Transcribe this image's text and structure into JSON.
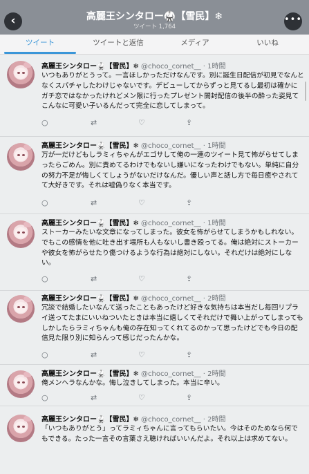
{
  "header": {
    "title": "高麗王シンタロー🥋【雪民】❄",
    "subtitle": "ツイート 1,764",
    "back_glyph": "‹",
    "more_glyph": "•••"
  },
  "tabs": [
    {
      "label": "ツイート",
      "active": true
    },
    {
      "label": "ツイートと返信",
      "active": false
    },
    {
      "label": "メディア",
      "active": false
    },
    {
      "label": "いいね",
      "active": false
    }
  ],
  "action_icons": {
    "reply": "○",
    "retweet": "⇄",
    "like": "♡",
    "share": "⇪"
  },
  "tweets": [
    {
      "name": "高麗王シンタロー🥋【雪民】❄",
      "handle": "@choco_cornet__ · 1時間",
      "text": "いつもありがとうって。一言ほしかっただけなんです。別に誕生日配信が初見でなんとなくスパチャしたわけじゃないです。デビューしてからずっと見てるし最初は確かにガチ恋ではなかったけれどメン限に行ったプレゼント開封配信の後半の酔った姿見てこんなに可愛い子いるんだって完全に恋してしまって。"
    },
    {
      "name": "高麗王シンタロー🥋【雪民】❄",
      "handle": "@choco_cornet__ · 1時間",
      "text": "万が一だけどもしラミィちゃんがエゴサして俺の一連のツイート見て怖がらせてしまったらごめん。別に責めてるわけでもないし嫌いになったわけでもない。単純に自分の努力不足が悔しくてしょうがないだけなんだ。優しい声と話し方で毎日癒やされてて大好きです。それは嘘偽りなく本当です。"
    },
    {
      "name": "高麗王シンタロー🥋【雪民】❄",
      "handle": "@choco_cornet__ · 1時間",
      "text": "ストーカーみたいな文章になってしまった。彼女を怖がらせてしまうかもしれない。でもこの感情を他に吐き出す場所も人もないし書き殴ってる。俺は絶対にストーカーや彼女を怖がらせたり傷つけるような行為は絶対にしない。それだけは絶対にしない。"
    },
    {
      "name": "高麗王シンタロー🥋【雪民】❄",
      "handle": "@choco_cornet__ · 2時間",
      "text": "冗談で結婚したいなんて送ったこともあったけど好きな気持ちは本当だし毎回リプライ送ってたまにいいねついたときは本当に嬉しくてそれだけで舞い上がってしまってもしかしたらラミィちゃんも俺の存在知ってくれてるのかって思ったけどでも今日の配信見た限り別に知らんって感じだったんかな。"
    },
    {
      "name": "高麗王シンタロー🥋【雪民】❄",
      "handle": "@choco_cornet__ · 2時間",
      "text": "俺メンヘラなんかな。悔し泣きしてしまった。本当に辛い。"
    },
    {
      "name": "高麗王シンタロー🥋【雪民】❄",
      "handle": "@choco_cornet__ · 2時間",
      "text": "「いつもありがとう」ってラミィちゃんに言ってもらいたい。今はそのためなら何でもできる。たった一言その言葉さえ聴ければいいんだよ。それ以上は求めてない。"
    }
  ]
}
